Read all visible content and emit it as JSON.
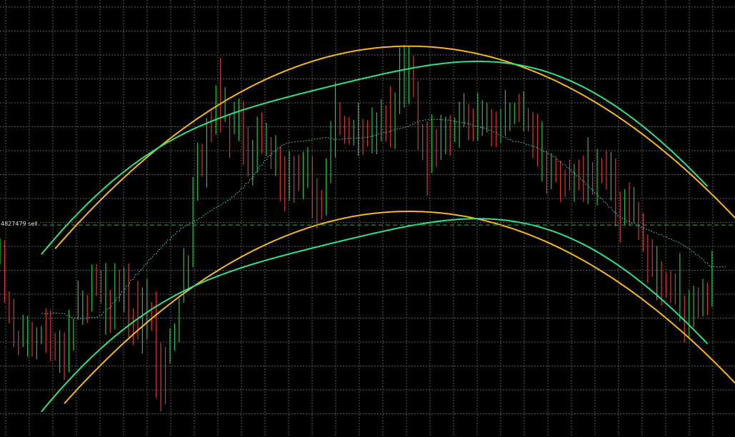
{
  "chart_data": {
    "type": "candlestick",
    "grid": true,
    "background": "#000000",
    "colors": {
      "grid": "#5a5a5a",
      "bull": "#22c24a",
      "bear": "#d23a3a",
      "regression_bands": "#2ee08a",
      "bands_alt": "#f4b81a",
      "midline": "#3fb8a8",
      "order_line": "#1fc23a"
    },
    "ylim": [
      0,
      100
    ],
    "xlim": [
      0,
      160
    ],
    "order_line": {
      "label": "4827479 sell",
      "y": 48.5
    },
    "candles": {
      "count": 156,
      "close": [
        42.1,
        39.5,
        30.7,
        26.0,
        20.6,
        22.3,
        24.1,
        18.4,
        22.0,
        25.5,
        25.2,
        24.7,
        21.2,
        21.3,
        16.1,
        20.9,
        26.4,
        27.6,
        30.5,
        29.8,
        37.6,
        36.9,
        34.8,
        37.2,
        27.3,
        34.2,
        33.9,
        36.5,
        28.8,
        27.3,
        25.6,
        29.2,
        31.5,
        27.2,
        26.0,
        12.2,
        10.3,
        22.2,
        23.0,
        30.3,
        36.1,
        39.4,
        56.7,
        65.2,
        63.5,
        71.3,
        70.8,
        78.8,
        75.7,
        78.0,
        71.4,
        72.3,
        76.9,
        72.3,
        61.1,
        62.4,
        71.0,
        66.7,
        68.4,
        67.3,
        67.3,
        61.8,
        56.1,
        62.5,
        60.8,
        59.1,
        60.4,
        63.1,
        59.4,
        55.4,
        51.7,
        61.5,
        66.4,
        72.5,
        72.2,
        71.2,
        70.4,
        71.7,
        72.4,
        70.6,
        67.2,
        68.3,
        72.4,
        73.0,
        70.5,
        70.4,
        73.4,
        76.6,
        85.4,
        85.9,
        81.9,
        79.6,
        69.0,
        65.1,
        70.3,
        65.5,
        67.1,
        71.3,
        69.3,
        70.4,
        70.8,
        76.8,
        73.6,
        71.1,
        71.5,
        71.5,
        73.8,
        72.9,
        69.8,
        73.3,
        73.8,
        73.9,
        74.4,
        74.2,
        74.8,
        73.6,
        70.9,
        66.6,
        70.7,
        61.8,
        62.5,
        61.9,
        60.7,
        60.3,
        58.5,
        59.8,
        59.2,
        56.5,
        61.4,
        59.9,
        64.4,
        61.7,
        60.4,
        61.9,
        60.3,
        51.5,
        53.0,
        51.5,
        52.4,
        48.7,
        48.1,
        43.5,
        37.5,
        40.0,
        37.9,
        35.4,
        35.2,
        34.1,
        35.7,
        25.6,
        30.0,
        33.0,
        29.6,
        31.3,
        30.8,
        32.4,
        46.2,
        47.7,
        49.0,
        46.6
      ],
      "high": [
        45.5,
        45.0,
        33.3,
        31.6,
        24.3,
        28.0,
        27.7,
        26.4,
        25.1,
        25.4,
        29.5,
        29.0,
        23.8,
        24.4,
        23.9,
        29.1,
        27.1,
        35.8,
        33.5,
        32.5,
        39.5,
        39.6,
        38.1,
        39.8,
        33.7,
        39.8,
        38.3,
        38.8,
        39.7,
        29.4,
        35.7,
        34.2,
        36.2,
        30.9,
        33.3,
        21.5,
        20.6,
        24.8,
        26.0,
        31.7,
        43.2,
        41.6,
        59.5,
        67.4,
        67.1,
        73.0,
        75.1,
        80.5,
        86.7,
        80.1,
        74.0,
        76.7,
        77.5,
        76.9,
        71.0,
        68.0,
        73.3,
        74.3,
        71.9,
        68.6,
        69.1,
        66.6,
        64.3,
        65.4,
        64.3,
        64.6,
        65.3,
        66.3,
        64.3,
        59.2,
        56.5,
        63.8,
        72.3,
        81.3,
        76.6,
        73.5,
        73.2,
        72.6,
        76.5,
        72.8,
        72.5,
        75.4,
        74.3,
        77.3,
        75.9,
        80.2,
        78.8,
        89.1,
        89.7,
        89.3,
        87.2,
        81.4,
        71.6,
        72.2,
        73.8,
        70.5,
        73.7,
        73.3,
        73.6,
        73.1,
        76.7,
        78.7,
        76.2,
        75.1,
        78.7,
        77.1,
        76.5,
        75.0,
        74.4,
        75.1,
        79.4,
        76.5,
        76.5,
        78.5,
        79.1,
        75.3,
        74.4,
        74.0,
        72.3,
        65.3,
        64.9,
        63.8,
        63.2,
        61.2,
        63.5,
        62.5,
        63.5,
        64.4,
        68.6,
        62.9,
        65.9,
        63.8,
        65.6,
        65.2,
        63.7,
        56.1,
        56.7,
        58.3,
        57.2,
        53.8,
        51.2,
        46.3,
        45.3,
        43.7,
        40.2,
        37.6,
        38.1,
        37.4,
        42.1,
        32.4,
        33.6,
        34.6,
        34.2,
        36.2,
        35.4,
        42.6,
        49.2,
        53.1,
        53.0,
        53.0
      ],
      "low": [
        39.5,
        30.7,
        26.0,
        20.6,
        18.7,
        20.6,
        18.4,
        18.4,
        17.8,
        21.2,
        19.3,
        17.4,
        17.5,
        14.7,
        13.0,
        14.8,
        19.8,
        26.8,
        25.7,
        26.1,
        28.7,
        32.3,
        30.6,
        23.4,
        23.8,
        24.6,
        30.9,
        28.5,
        22.8,
        21.0,
        22.3,
        19.1,
        22.4,
        24.3,
        9.0,
        5.9,
        7.5,
        16.9,
        19.7,
        21.7,
        30.7,
        33.5,
        38.8,
        54.1,
        59.6,
        57.1,
        67.5,
        69.2,
        69.7,
        72.1,
        63.9,
        69.3,
        67.7,
        62.3,
        59.6,
        57.6,
        60.5,
        64.9,
        64.3,
        61.3,
        59.7,
        53.9,
        51.7,
        54.1,
        53.6,
        56.3,
        54.4,
        57.0,
        50.1,
        47.7,
        49.9,
        50.7,
        58.1,
        64.0,
        69.1,
        67.1,
        66.9,
        66.7,
        64.4,
        64.6,
        66.5,
        64.9,
        64.7,
        67.6,
        67.6,
        66.3,
        65.9,
        73.9,
        75.4,
        76.2,
        77.7,
        65.7,
        63.3,
        55.2,
        60.4,
        61.8,
        63.4,
        64.7,
        64.4,
        67.5,
        66.2,
        71.0,
        67.9,
        67.7,
        67.8,
        68.9,
        69.7,
        66.5,
        66.3,
        67.3,
        68.9,
        70.0,
        71.6,
        72.1,
        70.0,
        69.9,
        63.8,
        61.9,
        58.5,
        55.7,
        56.7,
        58.3,
        53.8,
        54.9,
        56.4,
        53.8,
        56.5,
        53.8,
        53.3,
        55.4,
        53.0,
        58.1,
        56.6,
        54.1,
        48.2,
        44.5,
        48.6,
        48.3,
        49.1,
        45.1,
        42.4,
        35.3,
        36.6,
        31.3,
        30.0,
        32.0,
        30.7,
        30.3,
        26.5,
        21.7,
        22.4,
        25.2,
        27.1,
        27.6,
        27.9,
        29.9,
        41.6,
        44.4,
        45.2,
        44.8
      ]
    }
  }
}
